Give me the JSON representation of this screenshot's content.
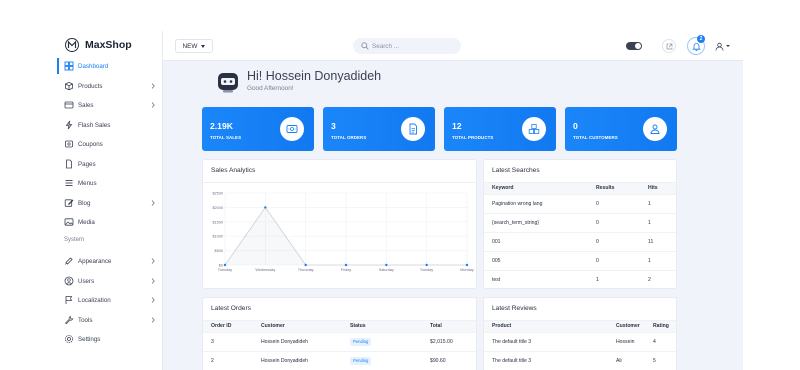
{
  "brand": {
    "name": "MaxShop"
  },
  "sidebar": {
    "items": [
      {
        "label": "Dashboard",
        "icon": "dashboard-icon",
        "active": true,
        "chevron": false
      },
      {
        "label": "Products",
        "icon": "box-icon",
        "active": false,
        "chevron": true
      },
      {
        "label": "Sales",
        "icon": "credit-card-icon",
        "active": false,
        "chevron": true
      },
      {
        "label": "Flash Sales",
        "icon": "flash-icon",
        "active": false,
        "chevron": false
      },
      {
        "label": "Coupons",
        "icon": "coupon-icon",
        "active": false,
        "chevron": false
      },
      {
        "label": "Pages",
        "icon": "page-icon",
        "active": false,
        "chevron": false
      },
      {
        "label": "Menus",
        "icon": "menu-icon",
        "active": false,
        "chevron": false
      },
      {
        "label": "Blog",
        "icon": "edit-icon",
        "active": false,
        "chevron": true
      },
      {
        "label": "Media",
        "icon": "image-icon",
        "active": false,
        "chevron": false
      }
    ],
    "section_label": "System",
    "system_items": [
      {
        "label": "Appearance",
        "icon": "paint-icon",
        "chevron": true
      },
      {
        "label": "Users",
        "icon": "user-circle-icon",
        "chevron": true
      },
      {
        "label": "Localization",
        "icon": "flag-icon",
        "chevron": true
      },
      {
        "label": "Tools",
        "icon": "wrench-icon",
        "chevron": true
      },
      {
        "label": "Settings",
        "icon": "gear-icon",
        "chevron": false
      }
    ]
  },
  "topbar": {
    "new_label": "NEW",
    "search_placeholder": "Search ...",
    "notification_count": "2"
  },
  "greeting": {
    "title": "Hi! Hossein Donyadideh",
    "subtitle": "Good Afternoon!"
  },
  "stats": [
    {
      "value": "2.19K",
      "caption": "TOTAL SALES",
      "icon": "money-icon"
    },
    {
      "value": "3",
      "caption": "TOTAL ORDERS",
      "icon": "document-icon"
    },
    {
      "value": "12",
      "caption": "TOTAL PRODUCTS",
      "icon": "cubes-icon"
    },
    {
      "value": "0",
      "caption": "TOTAL CUSTOMERS",
      "icon": "users-icon"
    }
  ],
  "sales_panel": {
    "title": "Sales Analytics"
  },
  "chart_data": {
    "type": "line",
    "title": "Sales Analytics",
    "categories": [
      "Tuesday",
      "Wednesday",
      "Thursday",
      "Friday",
      "Saturday",
      "Sunday",
      "Monday"
    ],
    "values": [
      0,
      2000,
      0,
      0,
      0,
      0,
      0
    ],
    "y_ticks": [
      "$0",
      "$500",
      "$1000",
      "$1500",
      "$2000",
      "$2500"
    ],
    "ylim": [
      0,
      2500
    ],
    "grid": true,
    "colors": {
      "line": "#c9ced8",
      "point": "#1b7ef5"
    }
  },
  "searches_panel": {
    "title": "Latest Searches",
    "columns": [
      "Keyword",
      "Results",
      "Hits"
    ],
    "rows": [
      [
        "Pagination wrong lang",
        "0",
        "1"
      ],
      [
        "{search_term_string}",
        "0",
        "1"
      ],
      [
        "001",
        "0",
        "11"
      ],
      [
        "005",
        "0",
        "1"
      ],
      [
        "test",
        "1",
        "2"
      ]
    ]
  },
  "orders_panel": {
    "title": "Latest Orders",
    "columns": [
      "Order ID",
      "Customer",
      "Status",
      "Total"
    ],
    "rows": [
      [
        "3",
        "Hossein Donyadideh",
        "Pending",
        "$2,015.00"
      ],
      [
        "2",
        "Hossein Donyadideh",
        "Pending",
        "$90.60"
      ]
    ]
  },
  "reviews_panel": {
    "title": "Latest Reviews",
    "columns": [
      "Product",
      "Customer",
      "Rating"
    ],
    "rows": [
      [
        "The default title 3",
        "Hossein",
        "4"
      ],
      [
        "The default title 3",
        "Ali",
        "5"
      ]
    ]
  },
  "colors": {
    "accent": "#1b7ef5",
    "background": "#f1f3fa"
  }
}
